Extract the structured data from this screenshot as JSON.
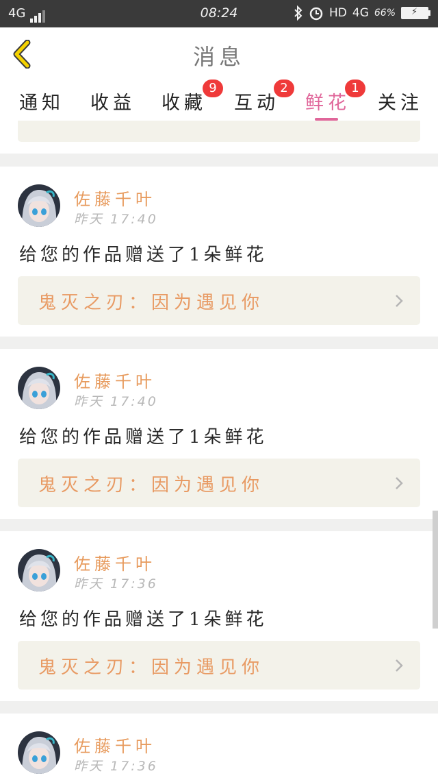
{
  "status": {
    "network": "4G",
    "time": "08:24",
    "hd": "HD",
    "net2": "4G",
    "speed": "66%"
  },
  "header": {
    "title": "消息"
  },
  "tabs": [
    {
      "label": "通知",
      "badge": ""
    },
    {
      "label": "收益",
      "badge": ""
    },
    {
      "label": "收藏",
      "badge": "9"
    },
    {
      "label": "互动",
      "badge": "2"
    },
    {
      "label": "鲜花",
      "badge": "1"
    },
    {
      "label": "关注",
      "badge": ""
    }
  ],
  "active_tab": "鲜花",
  "messages": [
    {
      "user": "佐藤千叶",
      "time": "昨天 17:40",
      "text": "给您的作品赠送了1朵鲜花",
      "work": "鬼灭之刃：因为遇见你"
    },
    {
      "user": "佐藤千叶",
      "time": "昨天 17:40",
      "text": "给您的作品赠送了1朵鲜花",
      "work": "鬼灭之刃：因为遇见你"
    },
    {
      "user": "佐藤千叶",
      "time": "昨天 17:36",
      "text": "给您的作品赠送了1朵鲜花",
      "work": "鬼灭之刃：因为遇见你"
    },
    {
      "user": "佐藤千叶",
      "time": "昨天 17:36",
      "text": "",
      "work": ""
    }
  ],
  "colors": {
    "accent": "#e0669a",
    "badge": "#ef3a3a",
    "username": "#e79a5c",
    "back_arrow": "#f5d200"
  }
}
